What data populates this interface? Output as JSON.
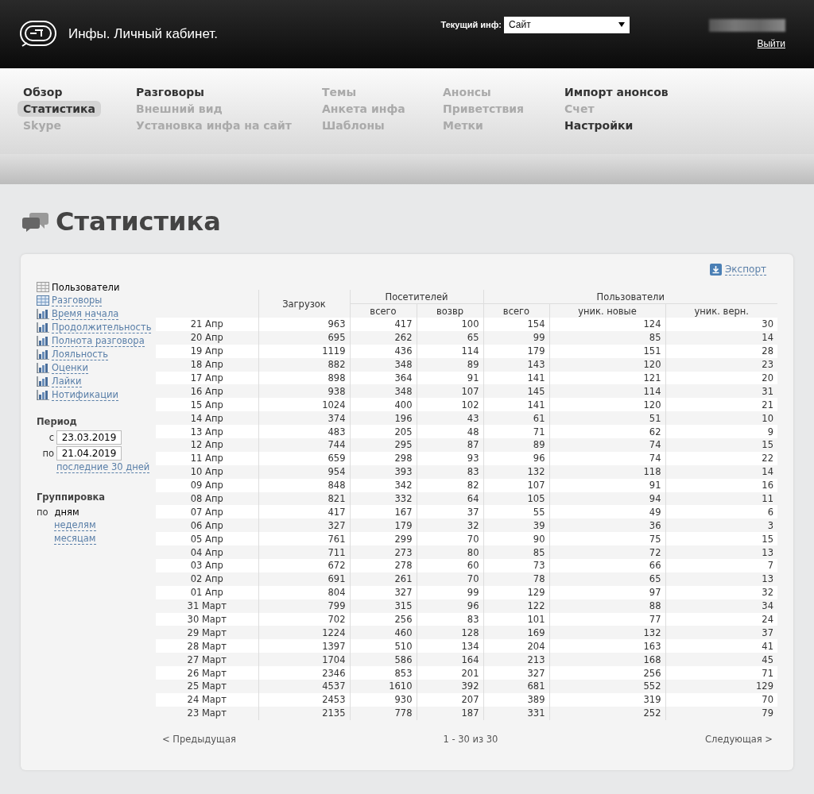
{
  "header": {
    "title": "Инфы. Личный кабинет.",
    "current_label": "Текущий инф:",
    "current_value": "Сайт",
    "logout": "Выйти"
  },
  "nav": {
    "columns": [
      [
        {
          "label": "Обзор",
          "disabled": false,
          "selected": false
        },
        {
          "label": "Статистика",
          "disabled": false,
          "selected": true
        },
        {
          "label": "Skype",
          "disabled": true,
          "selected": false
        }
      ],
      [
        {
          "label": "Разговоры",
          "disabled": false,
          "selected": false
        },
        {
          "label": "Внешний вид",
          "disabled": true,
          "selected": false
        },
        {
          "label": "Установка инфа на сайт",
          "disabled": true,
          "selected": false
        }
      ],
      [
        {
          "label": "Темы",
          "disabled": true,
          "selected": false
        },
        {
          "label": "Анкета инфа",
          "disabled": true,
          "selected": false
        },
        {
          "label": "Шаблоны",
          "disabled": true,
          "selected": false
        }
      ],
      [
        {
          "label": "Анонсы",
          "disabled": true,
          "selected": false
        },
        {
          "label": "Приветствия",
          "disabled": true,
          "selected": false
        },
        {
          "label": "Метки",
          "disabled": true,
          "selected": false
        }
      ],
      [
        {
          "label": "Импорт анонсов",
          "disabled": false,
          "selected": false
        },
        {
          "label": "Счет",
          "disabled": true,
          "selected": false
        },
        {
          "label": "Настройки",
          "disabled": false,
          "selected": false
        }
      ]
    ]
  },
  "page_title": "Статистика",
  "export": "Экспорт",
  "reports": [
    {
      "label": "Пользователи",
      "kind": "table",
      "selected": true
    },
    {
      "label": "Разговоры",
      "kind": "table",
      "selected": false
    },
    {
      "label": "Время начала",
      "kind": "chart",
      "selected": false
    },
    {
      "label": "Продолжительность",
      "kind": "chart",
      "selected": false
    },
    {
      "label": "Полнота разговора",
      "kind": "chart",
      "selected": false
    },
    {
      "label": "Лояльность",
      "kind": "chart",
      "selected": false
    },
    {
      "label": "Оценки",
      "kind": "chart",
      "selected": false
    },
    {
      "label": "Лайки",
      "kind": "chart",
      "selected": false
    },
    {
      "label": "Нотификации",
      "kind": "chart",
      "selected": false
    }
  ],
  "period": {
    "title": "Период",
    "from_label": "с",
    "from": "23.03.2019",
    "to_label": "по",
    "to": "21.04.2019",
    "preset": "последние 30 дней"
  },
  "grouping": {
    "title": "Группировка",
    "prefix": "по",
    "options": [
      {
        "label": "дням",
        "selected": true
      },
      {
        "label": "неделям",
        "selected": false
      },
      {
        "label": "месяцам",
        "selected": false
      }
    ]
  },
  "table": {
    "col_loads": "Загрузок",
    "group_visitors": "Посетителей",
    "group_users": "Пользователи",
    "subcolumns": [
      "всего",
      "возвр",
      "всего",
      "уник. новые",
      "уник. верн."
    ],
    "rows": [
      [
        "21 Апр",
        "963",
        "417",
        "100",
        "154",
        "124",
        "30"
      ],
      [
        "20 Апр",
        "695",
        "262",
        "65",
        "99",
        "85",
        "14"
      ],
      [
        "19 Апр",
        "1119",
        "436",
        "114",
        "179",
        "151",
        "28"
      ],
      [
        "18 Апр",
        "882",
        "348",
        "89",
        "143",
        "120",
        "23"
      ],
      [
        "17 Апр",
        "898",
        "364",
        "91",
        "141",
        "121",
        "20"
      ],
      [
        "16 Апр",
        "938",
        "348",
        "107",
        "145",
        "114",
        "31"
      ],
      [
        "15 Апр",
        "1024",
        "400",
        "102",
        "141",
        "120",
        "21"
      ],
      [
        "14 Апр",
        "374",
        "196",
        "43",
        "61",
        "51",
        "10"
      ],
      [
        "13 Апр",
        "483",
        "205",
        "48",
        "71",
        "62",
        "9"
      ],
      [
        "12 Апр",
        "744",
        "295",
        "87",
        "89",
        "74",
        "15"
      ],
      [
        "11 Апр",
        "659",
        "298",
        "93",
        "96",
        "74",
        "22"
      ],
      [
        "10 Апр",
        "954",
        "393",
        "83",
        "132",
        "118",
        "14"
      ],
      [
        "09 Апр",
        "848",
        "342",
        "82",
        "107",
        "91",
        "16"
      ],
      [
        "08 Апр",
        "821",
        "332",
        "64",
        "105",
        "94",
        "11"
      ],
      [
        "07 Апр",
        "417",
        "167",
        "37",
        "55",
        "49",
        "6"
      ],
      [
        "06 Апр",
        "327",
        "179",
        "32",
        "39",
        "36",
        "3"
      ],
      [
        "05 Апр",
        "761",
        "299",
        "70",
        "90",
        "75",
        "15"
      ],
      [
        "04 Апр",
        "711",
        "273",
        "80",
        "85",
        "72",
        "13"
      ],
      [
        "03 Апр",
        "672",
        "278",
        "60",
        "73",
        "66",
        "7"
      ],
      [
        "02 Апр",
        "691",
        "261",
        "70",
        "78",
        "65",
        "13"
      ],
      [
        "01 Апр",
        "804",
        "327",
        "99",
        "129",
        "97",
        "32"
      ],
      [
        "31 Март",
        "799",
        "315",
        "96",
        "122",
        "88",
        "34"
      ],
      [
        "30 Март",
        "702",
        "256",
        "83",
        "101",
        "77",
        "24"
      ],
      [
        "29 Март",
        "1224",
        "460",
        "128",
        "169",
        "132",
        "37"
      ],
      [
        "28 Март",
        "1397",
        "510",
        "134",
        "204",
        "163",
        "41"
      ],
      [
        "27 Март",
        "1704",
        "586",
        "164",
        "213",
        "168",
        "45"
      ],
      [
        "26 Март",
        "2346",
        "853",
        "201",
        "327",
        "256",
        "71"
      ],
      [
        "25 Март",
        "4537",
        "1610",
        "392",
        "681",
        "552",
        "129"
      ],
      [
        "24 Март",
        "2453",
        "930",
        "207",
        "389",
        "319",
        "70"
      ],
      [
        "23 Март",
        "2135",
        "778",
        "187",
        "331",
        "252",
        "79"
      ]
    ]
  },
  "pager": {
    "prev": "< Предыдущая",
    "info": "1 - 30 из 30",
    "next": "Следующая >"
  }
}
